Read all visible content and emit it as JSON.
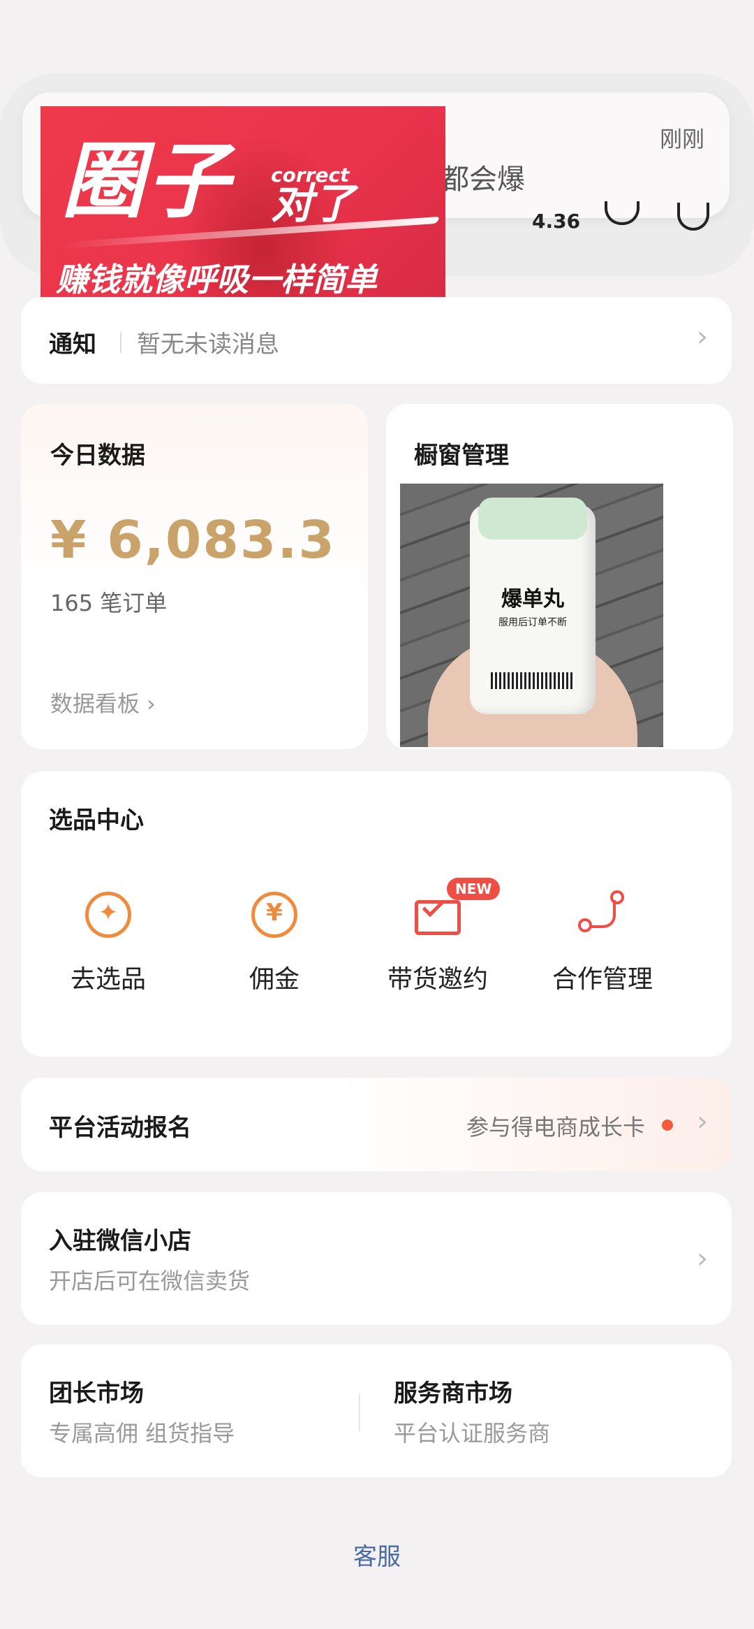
{
  "notification": {
    "time": "刚刚",
    "text": "都会爆"
  },
  "header": {
    "metric": "4.36"
  },
  "promo": {
    "title": "圈子",
    "correct": "correct",
    "dui": "对了",
    "slogan": "赚钱就像呼吸一样简单"
  },
  "notice": {
    "title": "通知",
    "message": "暂无未读消息"
  },
  "today": {
    "title": "今日数据",
    "amount": "¥ 6,083.3",
    "orders": "165 笔订单",
    "link": "数据看板 ›"
  },
  "window": {
    "title": "橱窗管理",
    "product_name": "爆单丸",
    "product_sub": "服用后订单不断"
  },
  "select_center": {
    "title": "选品中心",
    "items": [
      {
        "label": "去选品",
        "icon": "select-product-icon"
      },
      {
        "label": "佣金",
        "icon": "commission-yen-icon"
      },
      {
        "label": "带货邀约",
        "icon": "invite-envelope-icon",
        "badge": "NEW"
      },
      {
        "label": "合作管理",
        "icon": "cooperation-path-icon"
      }
    ]
  },
  "activity": {
    "title": "平台活动报名",
    "note": "参与得电商成长卡"
  },
  "shop": {
    "title": "入驻微信小店",
    "sub": "开店后可在微信卖货"
  },
  "market": {
    "left": {
      "title": "团长市场",
      "sub": "专属高佣 组货指导"
    },
    "right": {
      "title": "服务商市场",
      "sub": "平台认证服务商"
    }
  },
  "footer": {
    "service": "客服"
  },
  "colors": {
    "accent_gold": "#c9a36a",
    "accent_orange": "#f08a3c",
    "accent_red": "#ef4e45",
    "link_blue": "#4a6aa0"
  }
}
